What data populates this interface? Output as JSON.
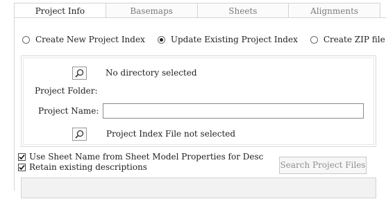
{
  "tabs": [
    {
      "label": "Project Info",
      "active": true
    },
    {
      "label": "Basemaps",
      "active": false
    },
    {
      "label": "Sheets",
      "active": false
    },
    {
      "label": "Alignments",
      "active": false
    }
  ],
  "radios": [
    {
      "label": "Create New Project Index",
      "checked": false
    },
    {
      "label": "Update Existing Project Index",
      "checked": true
    },
    {
      "label": "Create ZIP file",
      "checked": false
    }
  ],
  "group": {
    "directory_status": "No directory selected",
    "project_folder_label": "Project Folder:",
    "project_name_label": "Project Name:",
    "project_name_value": "",
    "index_file_status": "Project Index File not selected"
  },
  "checkboxes": [
    {
      "label": "Use Sheet Name from Sheet Model Properties for Desc",
      "checked": true
    },
    {
      "label": "Retain existing descriptions",
      "checked": true
    }
  ],
  "search_button_label": "Search Project Files",
  "status_text": "",
  "icons": {
    "browse": "magnifier-icon",
    "check": "checkmark-icon"
  }
}
